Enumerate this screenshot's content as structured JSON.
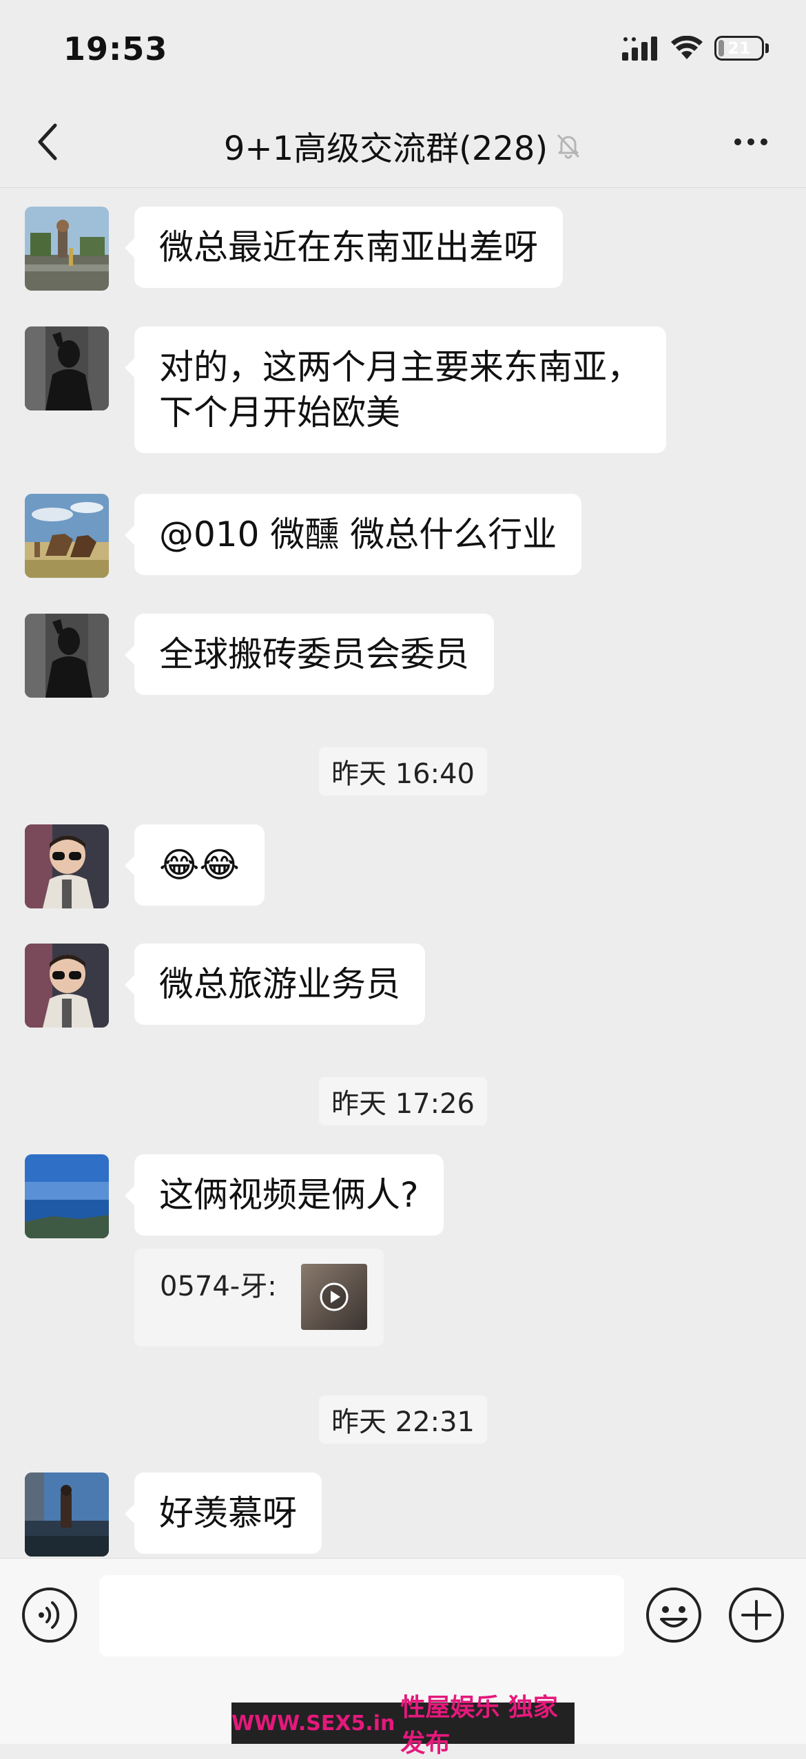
{
  "status_bar": {
    "time": "19:53",
    "battery": "21",
    "battery_level": 0.21
  },
  "nav": {
    "title": "9+1高级交流群(228)",
    "muted": true
  },
  "messages": [
    {
      "text": "微总最近在东南亚出差呀",
      "avatar": "street-photo"
    },
    {
      "text": "对的，这两个月主要来东南亚，\n下个月开始欧美",
      "avatar": "silhouette-photo"
    },
    {
      "text": "@010 微醺 微总什么行业",
      "avatar": "horses-photo"
    },
    {
      "text": "全球搬砖委员会委员",
      "avatar": "silhouette-photo"
    },
    {
      "text": "😂😂",
      "avatar": "child-sunglasses-photo"
    },
    {
      "text": "微总旅游业务员",
      "avatar": "child-sunglasses-photo"
    },
    {
      "text": "这俩视频是俩人?",
      "avatar": "sea-photo"
    },
    {
      "text": "好羡慕呀",
      "avatar": "lake-photo"
    }
  ],
  "timestamps": [
    "昨天 16:40",
    "昨天 17:26",
    "昨天 22:31"
  ],
  "quote": {
    "text": "0574-牙:"
  },
  "input": {
    "value": "",
    "placeholder": ""
  },
  "watermark": {
    "part1": "WWW.SEX5.in",
    "part2": "性屋娱乐 独家发布"
  },
  "colors": {
    "background": "#ededed",
    "bubble": "#ffffff",
    "watermark_text": "#e4197b"
  }
}
